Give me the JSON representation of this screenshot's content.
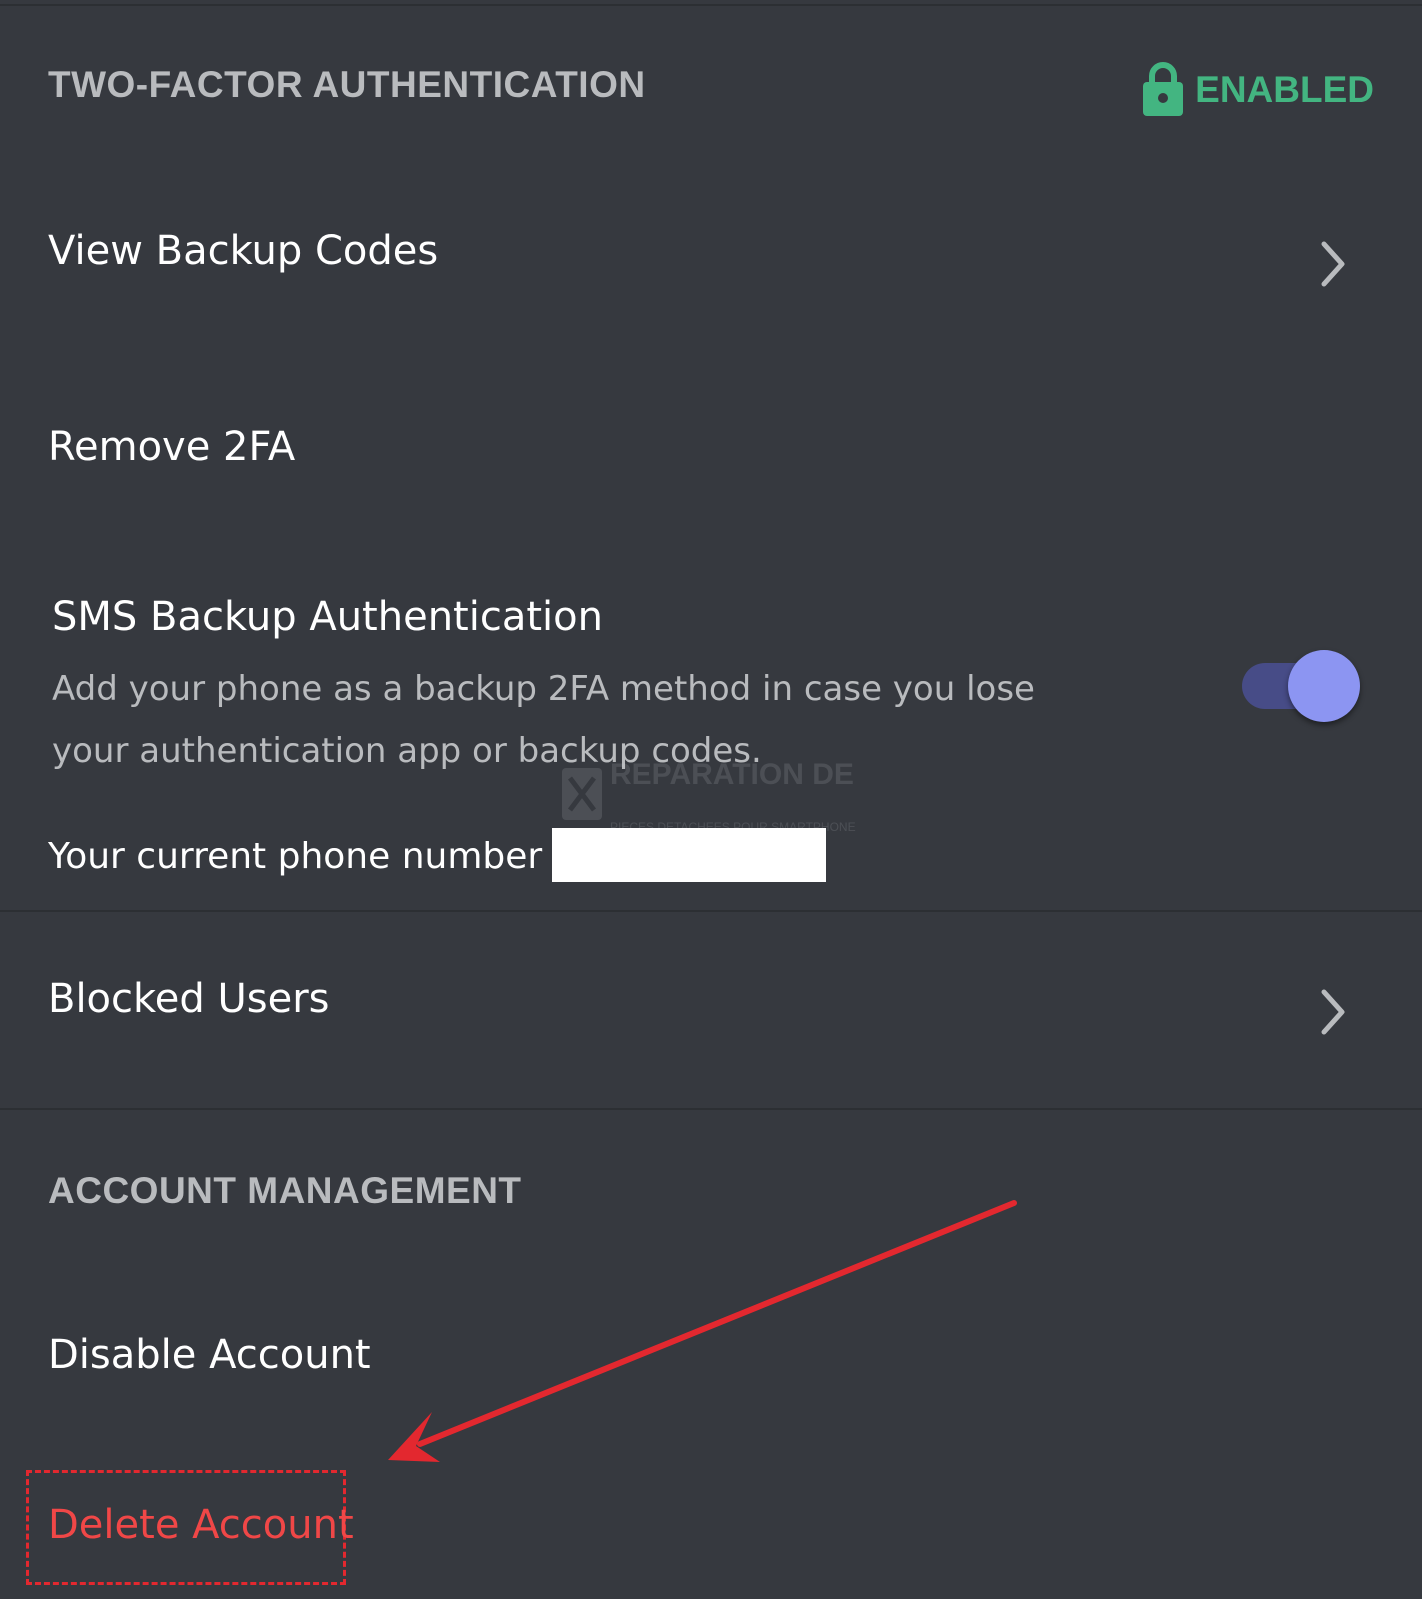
{
  "colors": {
    "background": "#36393f",
    "enabled_green": "#43b581",
    "danger_red": "#f04747",
    "toggle_on": "#8c95f2",
    "annotation_red": "#e3282f"
  },
  "two_factor": {
    "header": "TWO-FACTOR AUTHENTICATION",
    "status_icon": "lock-icon",
    "status_label": "ENABLED",
    "view_backup_codes": "View Backup Codes",
    "remove_2fa": "Remove 2FA"
  },
  "sms_backup": {
    "title": "SMS Backup Authentication",
    "description": "Add your phone as a backup 2FA method in case you lose your authentication app or backup codes.",
    "toggle_on": true,
    "phone_prefix": "Your current phone number is:"
  },
  "blocked_users": {
    "label": "Blocked Users"
  },
  "account_management": {
    "header": "ACCOUNT MANAGEMENT",
    "disable_account": "Disable Account",
    "delete_account": "Delete Account"
  },
  "watermark": {
    "line1": "REPARATION DE",
    "line2": "PIECES DETACHEES POUR SMARTPHONE"
  },
  "icons": {
    "chevron": "chevron-right-icon",
    "lock": "lock-icon",
    "arrow": "annotation-arrow"
  }
}
